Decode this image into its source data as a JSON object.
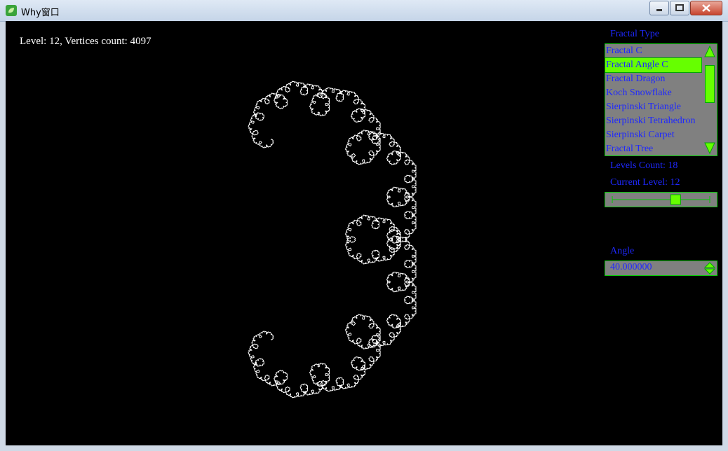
{
  "window": {
    "title": "Why窗口"
  },
  "info_text": "Level: 12, Vertices count: 4097",
  "panel": {
    "fractal_type_label": "Fractal Type",
    "fractal_types": [
      {
        "label": "Fractal C",
        "selected": false
      },
      {
        "label": "Fractal Angle C",
        "selected": true
      },
      {
        "label": "Fractal Dragon",
        "selected": false
      },
      {
        "label": "Koch Snowflake",
        "selected": false
      },
      {
        "label": "Sierpinski Triangle",
        "selected": false
      },
      {
        "label": "Sierpinski Tetrahedron",
        "selected": false
      },
      {
        "label": "Sierpinski Carpet",
        "selected": false
      },
      {
        "label": "Fractal Tree",
        "selected": false
      }
    ],
    "levels_count_label": "Levels Count: 18",
    "current_level_label": "Current Level: 12",
    "current_level_fraction": 0.65,
    "angle_label": "Angle",
    "angle_value": "40.000000"
  },
  "colors": {
    "accent": "#66ff00",
    "text": "#1e28ff",
    "canvas": "#000000",
    "control_bg": "#808080"
  }
}
